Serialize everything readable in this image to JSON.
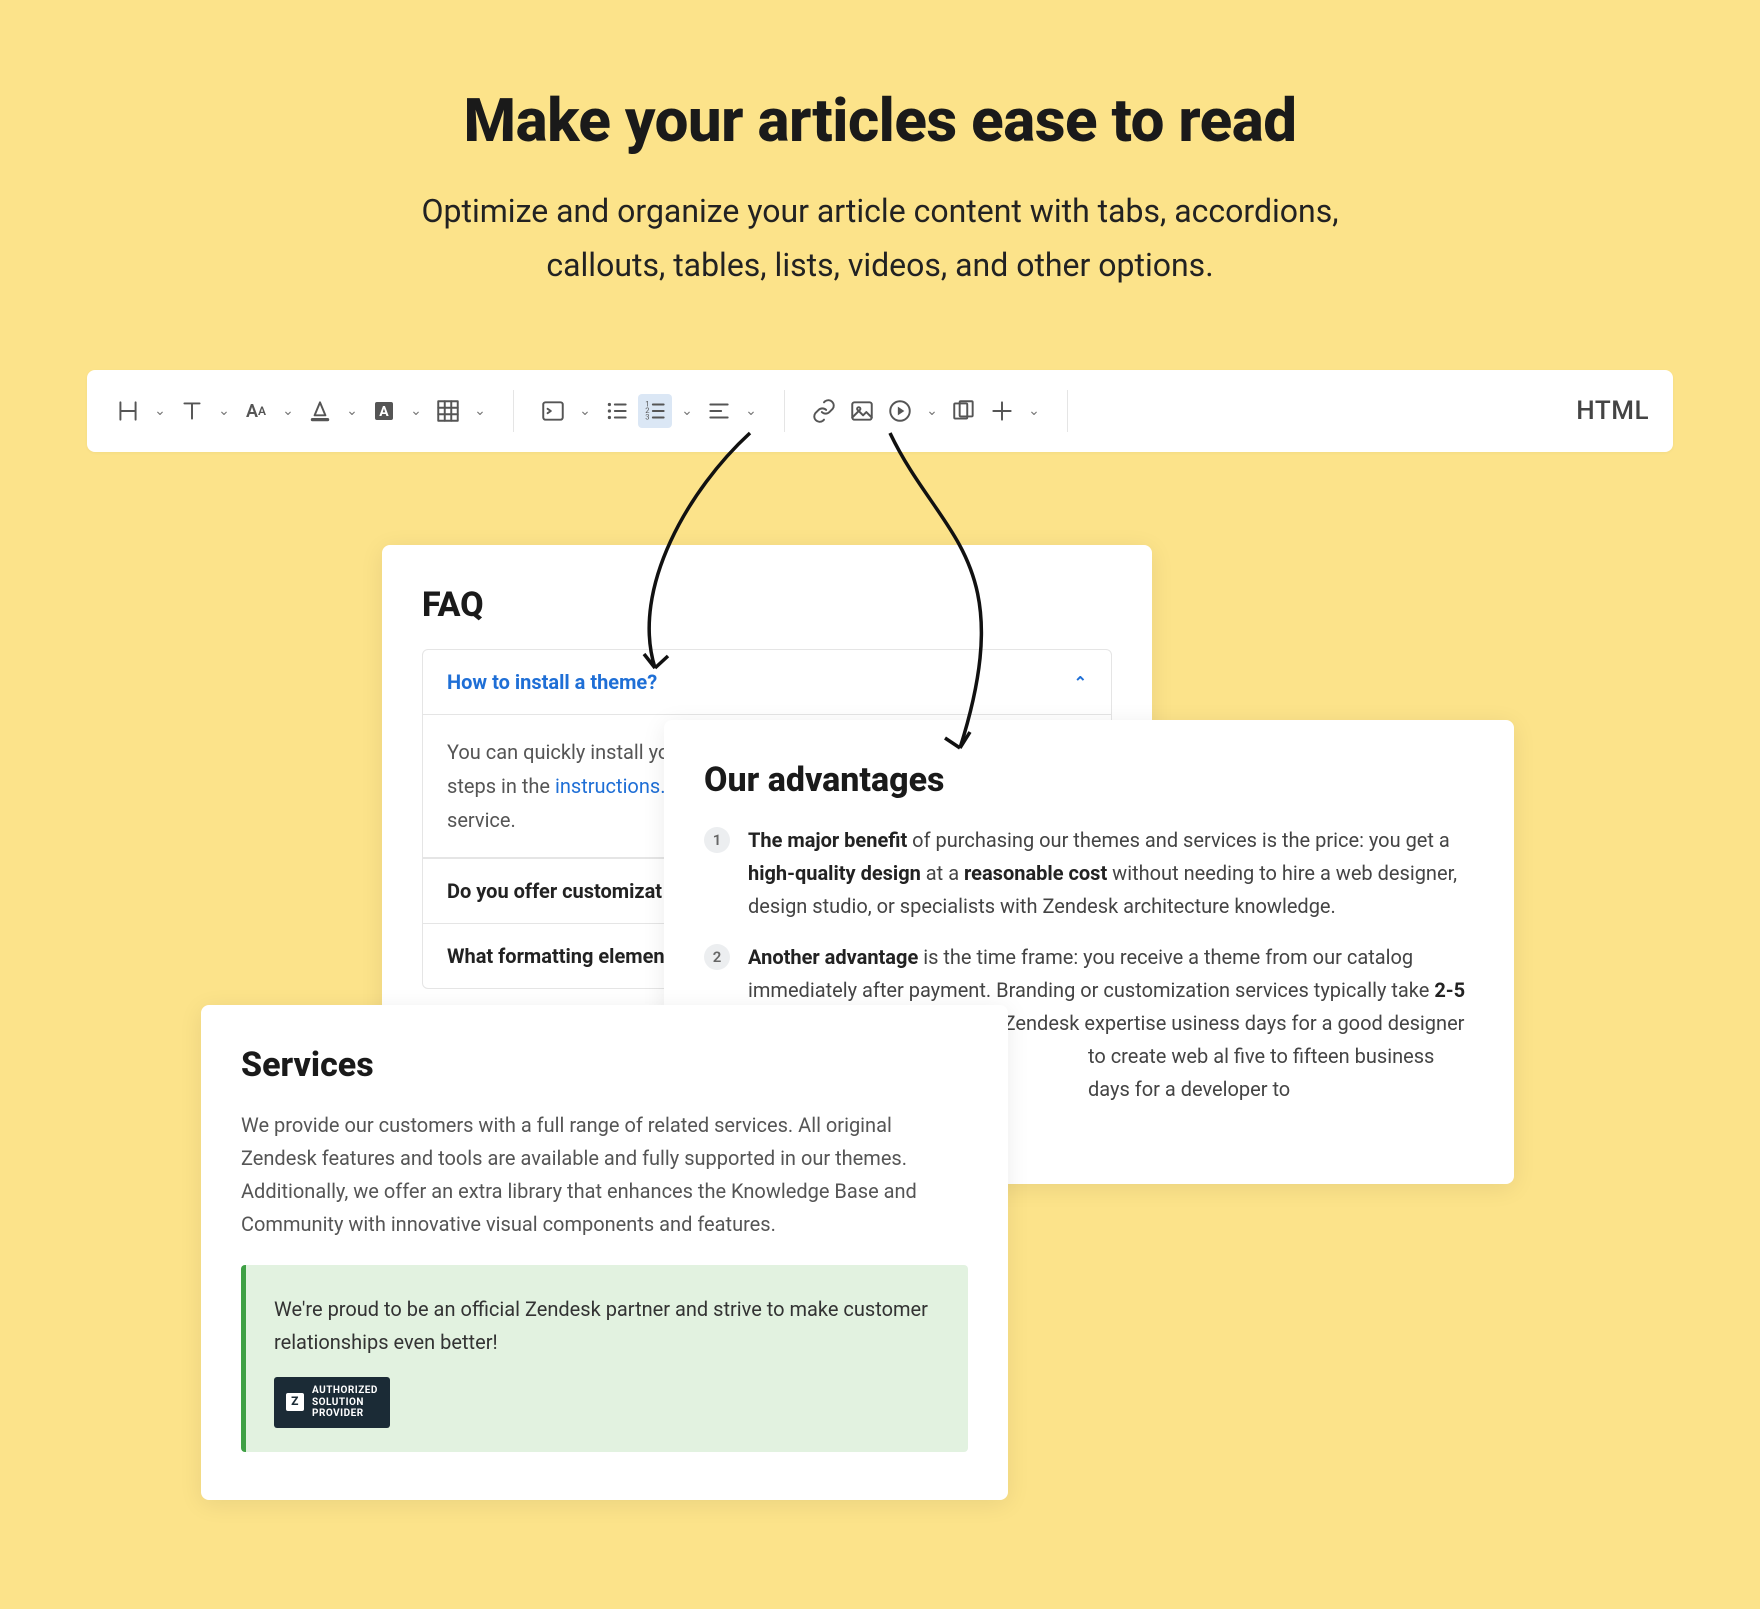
{
  "hero": {
    "title": "Make your articles ease to read",
    "subtitle": "Optimize and organize your article content with tabs, accordions, callouts, tables, lists, videos, and other options."
  },
  "toolbar": {
    "html_label": "HTML"
  },
  "faq": {
    "title": "FAQ",
    "q1": "How to install a theme?",
    "a1_pre": "You can quickly install yo",
    "a1_mid": "steps in the ",
    "a1_link": "instructions.",
    "a1_post": "service.",
    "q2": "Do you offer customizat",
    "q3": "What formatting elemen"
  },
  "advantages": {
    "title": "Our advantages",
    "item1_b1": "The major benefit",
    "item1_t1": " of purchasing our themes and services is the price: you get a ",
    "item1_b2": "high-quality design",
    "item1_t2": " at a ",
    "item1_b3": "reasonable cost",
    "item1_t3": " without needing to hire a web designer, design studio, or specialists with Zendesk architecture knowledge.",
    "item2_b1": "Another advantage",
    "item2_t1": " is the time frame: you receive a theme from our catalog immediately after payment. Branding or customization services typically take ",
    "item2_b2": "2-5",
    "item2_t2": " teams or specialists without Zendesk expertise usiness days for a good designer to create web al five to fifteen business days for a developer to"
  },
  "services": {
    "title": "Services",
    "body": "We provide our customers with a full range of related services. All original Zendesk features and tools are available and fully supported in our themes. Additionally, we offer an extra library that enhances the Knowledge Base and Community with innovative visual components and features.",
    "callout": "We're proud to be an official Zendesk partner and strive to make customer relationships even better!",
    "badge_line1": "AUTHORIZED",
    "badge_line2": "SOLUTION",
    "badge_line3": "PROVIDER"
  }
}
